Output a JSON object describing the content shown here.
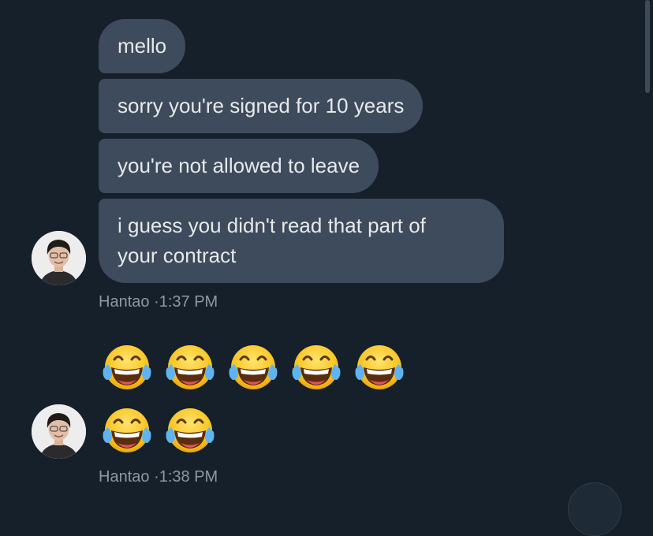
{
  "messages": [
    {
      "text": "mello"
    },
    {
      "text": "sorry you're signed for 10 years"
    },
    {
      "text": "you're not allowed to leave"
    },
    {
      "text": "i guess you didn't read that part of\nyour contract"
    }
  ],
  "group1_meta": {
    "sender": "Hantao",
    "separator": "·",
    "time": "1:37 PM"
  },
  "group2": {
    "emojis": [
      "face-with-tears-of-joy",
      "face-with-tears-of-joy",
      "face-with-tears-of-joy",
      "face-with-tears-of-joy",
      "face-with-tears-of-joy",
      "face-with-tears-of-joy",
      "face-with-tears-of-joy"
    ]
  },
  "group2_meta": {
    "sender": "Hantao",
    "separator": "·",
    "time": "1:38 PM"
  },
  "colors": {
    "background": "#15202b",
    "bubble": "#3d4b5c",
    "text": "#e7e9ea",
    "meta": "#8b98a5"
  }
}
